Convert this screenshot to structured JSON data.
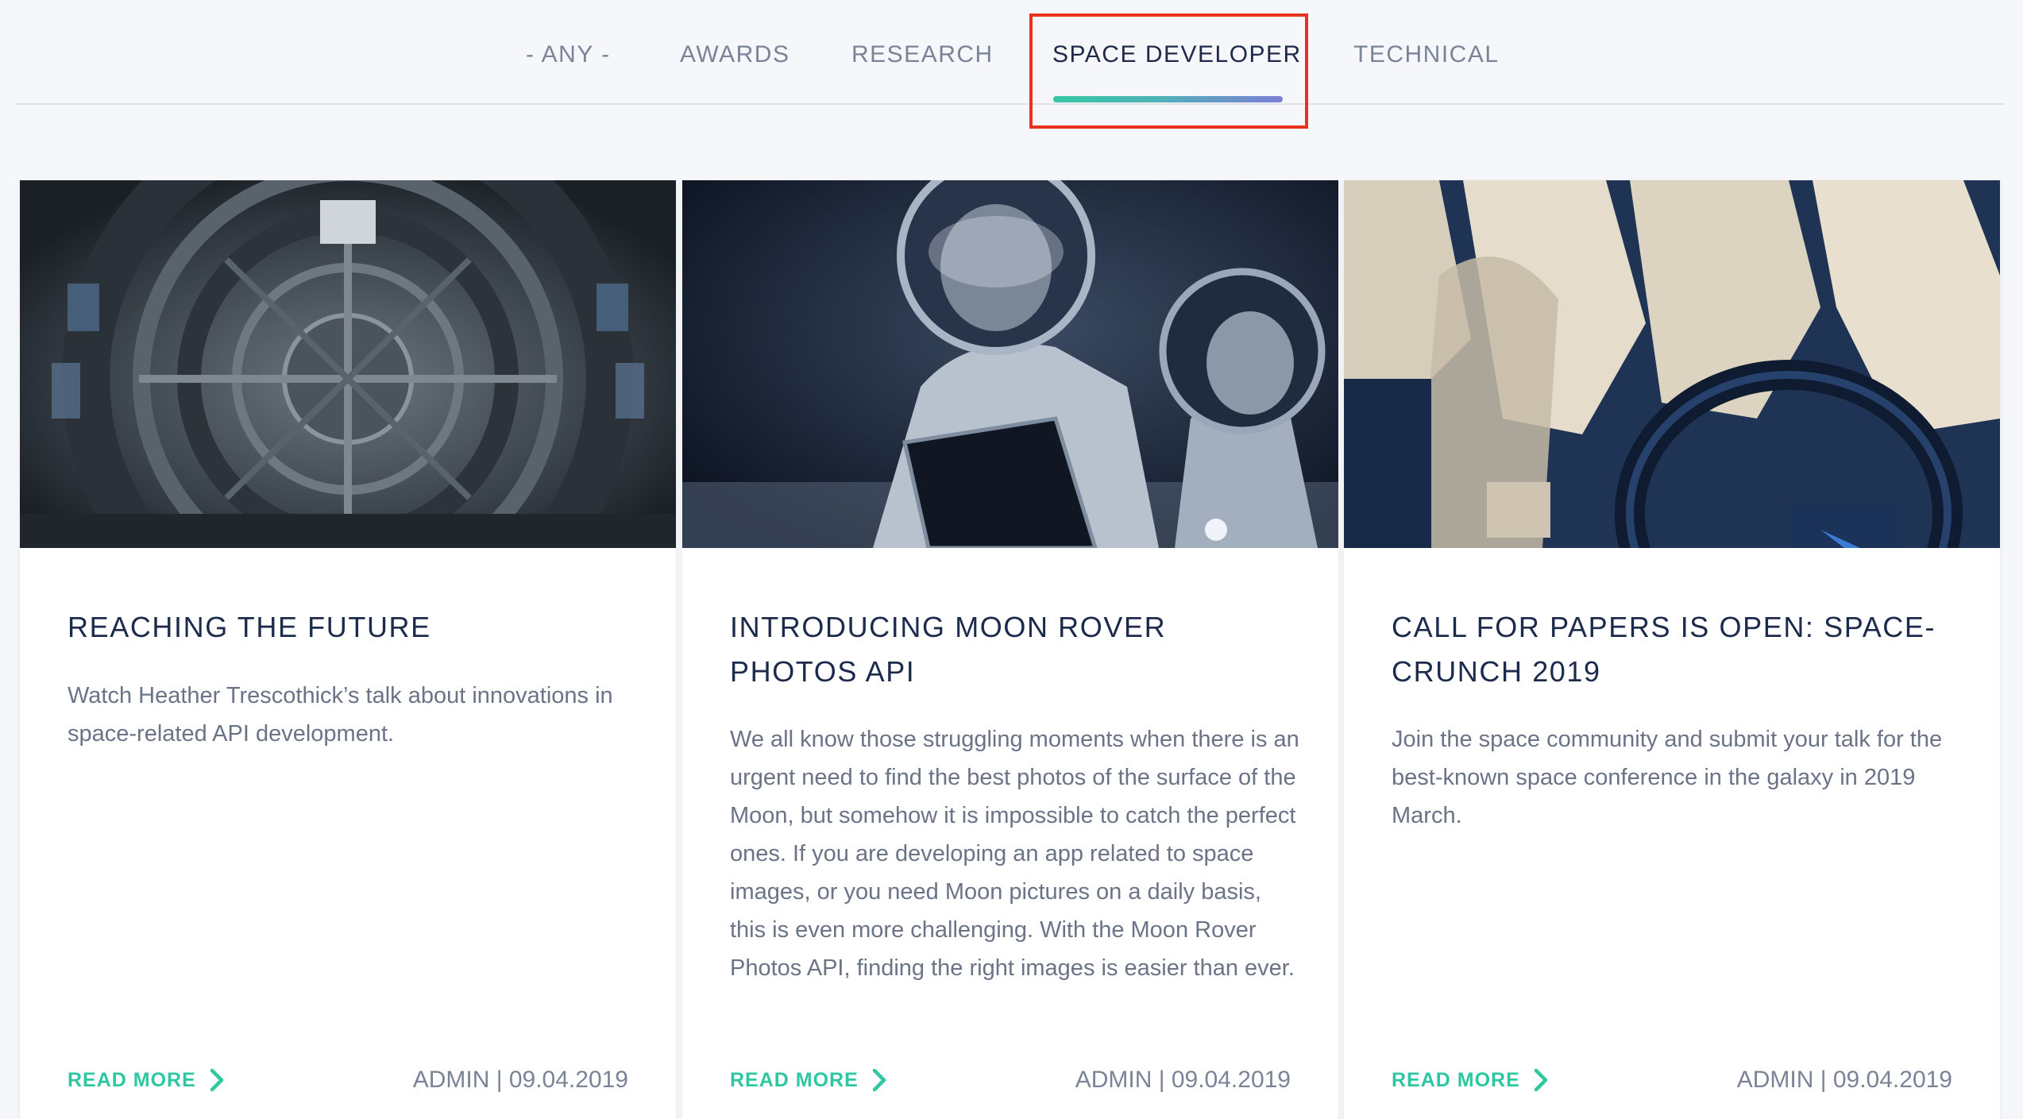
{
  "tabs": [
    {
      "label": "- ANY -",
      "active": false
    },
    {
      "label": "AWARDS",
      "active": false
    },
    {
      "label": "RESEARCH",
      "active": false
    },
    {
      "label": "SPACE DEVELOPER",
      "active": true
    },
    {
      "label": "TECHNICAL",
      "active": false
    }
  ],
  "colors": {
    "accent": "#2ec7a1",
    "accent_gradient_end": "#7b7fd4",
    "highlight": "#e8321f",
    "title": "#1c2a4c",
    "muted": "#7b8497"
  },
  "cards": [
    {
      "image": "space-station-corridor-image",
      "title": "REACHING THE FUTURE",
      "text": "Watch Heather Trescothick’s talk about innovations in space-related API development.",
      "read_more": "READ MORE",
      "meta": "ADMIN | 09.04.2019"
    },
    {
      "image": "astronauts-tablet-image",
      "title": "INTRODUCING MOON ROVER PHOTOS API",
      "text": "We all know those struggling moments when there is an urgent need to find the best photos of  the surface of the Moon, but somehow it is impossible to catch the perfect ones. If you are developing an app related to space images, or you need Moon pictures on a daily basis, this is even more challenging. With the Moon Rover Photos API, finding the right images is easier than ever.",
      "read_more": "READ MORE",
      "meta": "ADMIN | 09.04.2019"
    },
    {
      "image": "cockpit-seats-image",
      "title": "CALL FOR PAPERS IS OPEN: SPACE-CRUNCH 2019",
      "text": "Join the space community and submit your talk for the best-known space conference in the galaxy in 2019 March.",
      "read_more": "READ MORE",
      "meta": "ADMIN | 09.04.2019"
    }
  ]
}
